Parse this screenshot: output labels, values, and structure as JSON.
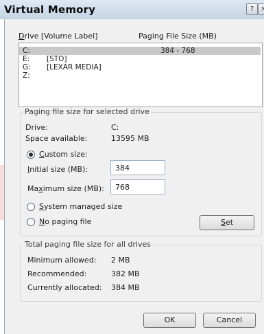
{
  "window": {
    "title": "Virtual Memory",
    "help_glyph": "?",
    "close_glyph": "✕"
  },
  "drive_list": {
    "col_drive": "Drive  [Volume Label]",
    "col_paging": "Paging File Size (MB)",
    "rows": [
      {
        "drive": "C:",
        "label": "",
        "size": "384 - 768"
      },
      {
        "drive": "E:",
        "label": "[STO]",
        "size": ""
      },
      {
        "drive": "G:",
        "label": "[LEXAR MEDIA]",
        "size": ""
      },
      {
        "drive": "Z:",
        "label": "",
        "size": ""
      }
    ]
  },
  "selected_drive": {
    "group_title": "Paging file size for selected drive",
    "drive_label": "Drive:",
    "drive_value": "C:",
    "space_label": "Space available:",
    "space_value": "13595 MB",
    "custom_label": "Custom size:",
    "initial_label": "Initial size (MB):",
    "initial_value": "384",
    "max_label": "Maximum size (MB):",
    "max_value": "768",
    "system_managed_label": "System managed size",
    "no_paging_label": "No paging file",
    "set_button": "Set",
    "selected_option": "custom"
  },
  "totals": {
    "group_title": "Total paging file size for all drives",
    "min_label": "Minimum allowed:",
    "min_value": "2 MB",
    "rec_label": "Recommended:",
    "rec_value": "382 MB",
    "alloc_label": "Currently allocated:",
    "alloc_value": "384 MB"
  },
  "buttons": {
    "ok": "OK",
    "cancel": "Cancel"
  }
}
